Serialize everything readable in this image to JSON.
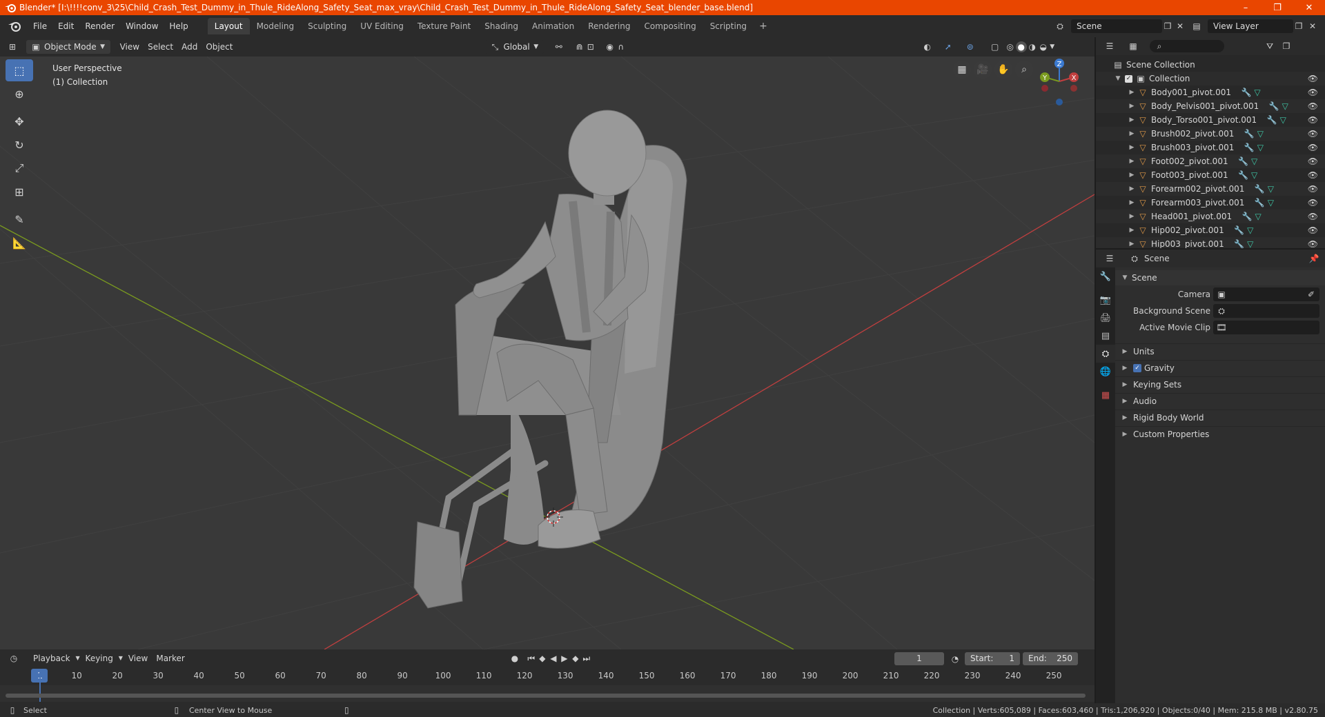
{
  "window": {
    "title": "Blender* [I:\\!!!!conv_3\\25\\Child_Crash_Test_Dummy_in_Thule_RideAlong_Safety_Seat_max_vray\\Child_Crash_Test_Dummy_in_Thule_RideAlong_Safety_Seat_blender_base.blend]",
    "minimize": "–",
    "maximize": "❐",
    "close": "✕"
  },
  "menu": [
    "File",
    "Edit",
    "Render",
    "Window",
    "Help"
  ],
  "workspaces": [
    {
      "label": "Layout",
      "active": true
    },
    {
      "label": "Modeling"
    },
    {
      "label": "Sculpting"
    },
    {
      "label": "UV Editing"
    },
    {
      "label": "Texture Paint"
    },
    {
      "label": "Shading"
    },
    {
      "label": "Animation"
    },
    {
      "label": "Rendering"
    },
    {
      "label": "Compositing"
    },
    {
      "label": "Scripting"
    }
  ],
  "workspace_add": "+",
  "scene_selector": "Scene",
  "view_layer": "View Layer",
  "viewport_header": {
    "mode": "Object Mode",
    "menus": [
      "View",
      "Select",
      "Add",
      "Object"
    ],
    "transform_orientation": "Global"
  },
  "viewport": {
    "perspective_label": "User Perspective",
    "collection_label": "(1) Collection",
    "gizmo": {
      "z": "Z",
      "y": "Y",
      "x": "X"
    }
  },
  "timeline": {
    "menus": [
      "Playback",
      "Keying",
      "View",
      "Marker"
    ],
    "current_frame": "1",
    "start_label": "Start:",
    "start": "1",
    "end_label": "End:",
    "end": "250",
    "ticks": [
      "1",
      "10",
      "20",
      "30",
      "40",
      "50",
      "60",
      "70",
      "80",
      "90",
      "100",
      "110",
      "120",
      "130",
      "140",
      "150",
      "160",
      "170",
      "180",
      "190",
      "200",
      "210",
      "220",
      "230",
      "240",
      "250"
    ]
  },
  "statusbar": {
    "left_action": "Select",
    "mid_action": "Center View to Mouse",
    "stats": "Collection | Verts:605,089 | Faces:603,460 | Tris:1,206,920 | Objects:0/40 | Mem: 215.8 MB | v2.80.75"
  },
  "outliner": {
    "root": "Scene Collection",
    "collection": "Collection",
    "items": [
      "Body001_pivot.001",
      "Body_Pelvis001_pivot.001",
      "Body_Torso001_pivot.001",
      "Brush002_pivot.001",
      "Brush003_pivot.001",
      "Foot002_pivot.001",
      "Foot003_pivot.001",
      "Forearm002_pivot.001",
      "Forearm003_pivot.001",
      "Head001_pivot.001",
      "Hip002_pivot.001",
      "Hip003_pivot.001"
    ]
  },
  "properties": {
    "context": "Scene",
    "panel": "Scene",
    "fields": [
      {
        "label": "Camera"
      },
      {
        "label": "Background Scene"
      },
      {
        "label": "Active Movie Clip"
      }
    ],
    "subpanels": [
      "Units",
      "Gravity",
      "Keying Sets",
      "Audio",
      "Rigid Body World",
      "Custom Properties"
    ]
  },
  "colors": {
    "titlebar": "#e94600",
    "accent": "#4772b3",
    "viewport_bg": "#393939",
    "axis_x": "#c13f3f",
    "axis_y": "#7a9a1f"
  }
}
